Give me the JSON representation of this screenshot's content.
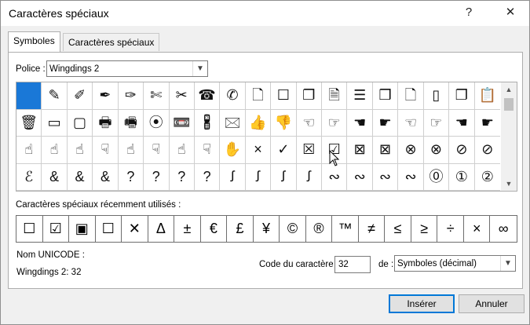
{
  "window": {
    "title": "Caractères spéciaux",
    "help_label": "?",
    "close_label": "✕"
  },
  "tabs": [
    {
      "label": "Symboles",
      "active": true
    },
    {
      "label": "Caractères spéciaux",
      "active": false
    }
  ],
  "font": {
    "label": "Police :",
    "value": "Wingdings 2"
  },
  "grid": {
    "rows": [
      [
        "",
        "✎",
        "✐",
        "✒",
        "✑",
        "✄",
        "✂",
        "☎",
        "✆",
        "🗋",
        "☐",
        "❐",
        "🗎",
        "☰",
        "❒",
        "🗋",
        "▯",
        "❐",
        "📋"
      ],
      [
        "🗑",
        "▭",
        "▢",
        "🖶",
        "🖷",
        "⦿",
        "📼",
        "🖁",
        "🖂",
        "👍",
        "👎",
        "☜",
        "☞",
        "☚",
        "☛",
        "☜",
        "☞",
        "☚",
        "☛"
      ],
      [
        "☝",
        "☝",
        "☝",
        "☟",
        "☝",
        "☟",
        "☝",
        "☟",
        "✋",
        "×",
        "✓",
        "☒",
        "☑",
        "⊠",
        "⊠",
        "⊗",
        "⊗",
        "⊘",
        "⊘"
      ],
      [
        "ℰ",
        "&",
        "&",
        "&",
        "?",
        "?",
        "?",
        "?",
        "ꭍ",
        "ꭍ",
        "ꭍ",
        "ꭍ",
        "∾",
        "∾",
        "∾",
        "∾",
        "⓪",
        "①",
        "②"
      ]
    ]
  },
  "recent": {
    "label": "Caractères spéciaux récemment utilisés :",
    "chars": [
      "☐",
      "☑",
      "▣",
      "☐",
      "✕",
      "Δ",
      "±",
      "€",
      "£",
      "¥",
      "©",
      "®",
      "™",
      "≠",
      "≤",
      "≥",
      "÷",
      "×",
      "∞"
    ]
  },
  "unicode": {
    "label": "Nom UNICODE :",
    "value": "Wingdings 2: 32"
  },
  "char_code": {
    "label": "Code du caractère :",
    "value": "32"
  },
  "from": {
    "label": "de :",
    "value": "Symboles (décimal)"
  },
  "buttons": {
    "insert": "Insérer",
    "cancel": "Annuler"
  },
  "colors": {
    "selection": "#1a78d7",
    "primary_border": "#0078d7"
  }
}
